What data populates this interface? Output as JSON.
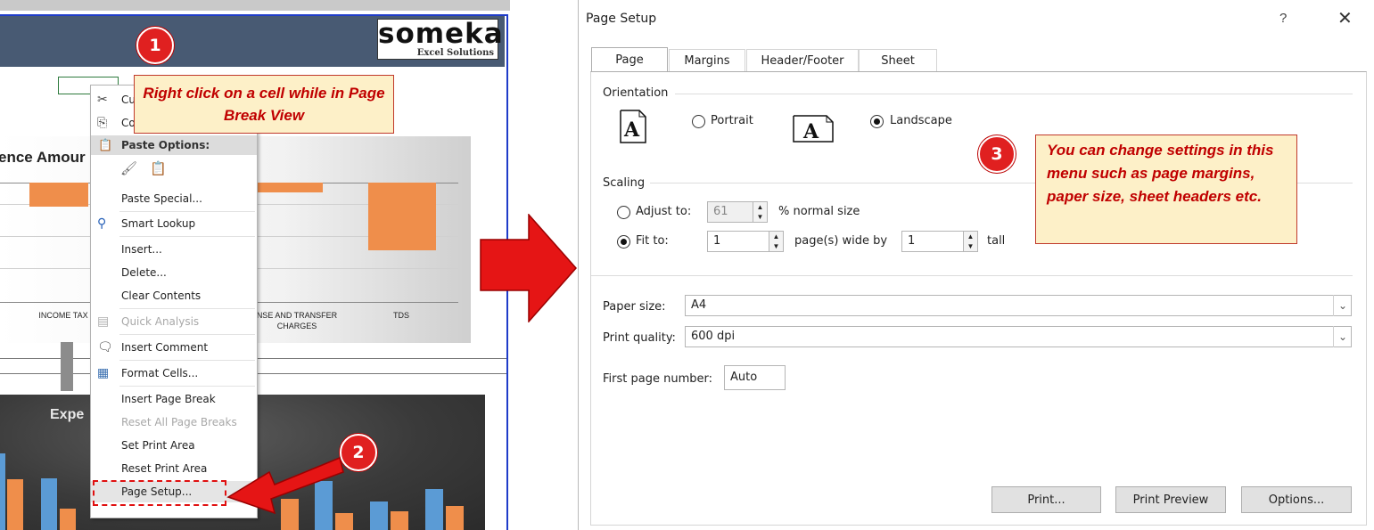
{
  "excel": {
    "logo_main": "someka",
    "logo_sub": "Excel Solutions",
    "chart1_title": "ence Amour",
    "chart1_categories": [
      "INCOME TAX",
      "NSE AND TRANSFER",
      "CHARGES",
      "TDS"
    ],
    "chart2_title": "Expe"
  },
  "context_menu": {
    "cut_label": "Cu",
    "copy_label": "Co",
    "paste_options_label": "Paste Options:",
    "paste_special_label": "Paste Special...",
    "smart_lookup_label": "Smart Lookup",
    "insert_label": "Insert...",
    "delete_label": "Delete...",
    "clear_contents_label": "Clear Contents",
    "quick_analysis_label": "Quick Analysis",
    "insert_comment_label": "Insert Comment",
    "format_cells_label": "Format Cells...",
    "insert_page_break_label": "Insert Page Break",
    "reset_all_page_breaks_label": "Reset All Page Breaks",
    "set_print_area_label": "Set Print Area",
    "reset_print_area_label": "Reset Print Area",
    "page_setup_label": "Page Setup..."
  },
  "callouts": {
    "badge1": "1",
    "badge2": "2",
    "badge3": "3",
    "step1_text": "Right click on a cell while in Page Break View",
    "step3_text": "You can change settings in this menu such as page margins, paper size, sheet headers etc."
  },
  "dialog": {
    "title": "Page Setup",
    "help_glyph": "?",
    "close_glyph": "✕",
    "tabs": [
      "Page",
      "Margins",
      "Header/Footer",
      "Sheet"
    ],
    "orientation_label": "Orientation",
    "portrait_label": "Portrait",
    "landscape_label": "Landscape",
    "scaling_label": "Scaling",
    "adjust_to_label": "Adjust to:",
    "adjust_value": "61",
    "normal_size_label": "% normal size",
    "fit_to_label": "Fit to:",
    "fit_wide_value": "1",
    "pages_wide_label": "page(s) wide by",
    "fit_tall_value": "1",
    "tall_label": "tall",
    "paper_size_label": "Paper size:",
    "paper_size_value": "A4",
    "print_quality_label": "Print quality:",
    "print_quality_value": "600 dpi",
    "first_page_label": "First page number:",
    "first_page_value": "Auto",
    "print_button": "Print...",
    "print_preview_button": "Print Preview",
    "options_button": "Options..."
  },
  "colors": {
    "accent_red": "#e02020",
    "callout_bg": "#fdf0c8",
    "callout_text": "#c00000"
  }
}
